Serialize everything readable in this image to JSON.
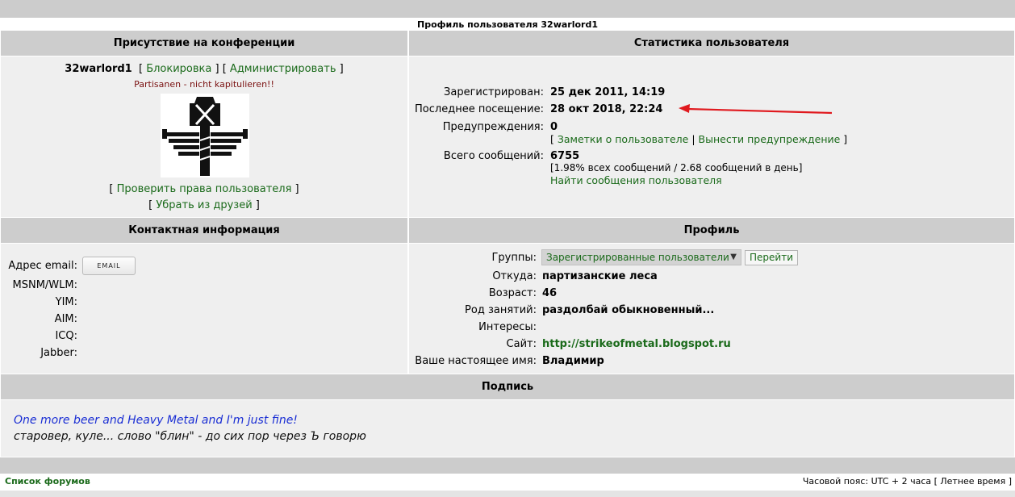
{
  "page": {
    "title": "Профиль пользователя 32warlord1"
  },
  "presence": {
    "header": "Присутствие на конференции",
    "username": "32warlord1",
    "block_link": "Блокировка",
    "admin_link": "Администрировать",
    "tagline": "Partisanen - nicht kapitulieren!!",
    "check_rights_link": "Проверить права пользователя",
    "remove_friend_link": "Убрать из друзей"
  },
  "stats": {
    "header": "Статистика пользователя",
    "registered_label": "Зарегистрирован:",
    "registered_value": "25 дек 2011, 14:19",
    "last_visit_label": "Последнее посещение:",
    "last_visit_value": "28 окт 2018, 22:24",
    "warnings_label": "Предупреждения:",
    "warnings_value": "0",
    "user_notes_link": "Заметки о пользователе",
    "issue_warning_link": "Вынести предупреждение",
    "total_posts_label": "Всего сообщений:",
    "total_posts_value": "6755",
    "posts_detail": "[1.98% всех сообщений / 2.68 сообщений в день]",
    "find_posts_link": "Найти сообщения пользователя"
  },
  "contact": {
    "header": "Контактная информация",
    "email_label": "Адрес email:",
    "email_button": "EMAIL",
    "msnm_label": "MSNM/WLM:",
    "yim_label": "YIM:",
    "aim_label": "AIM:",
    "icq_label": "ICQ:",
    "jabber_label": "Jabber:"
  },
  "profile": {
    "header": "Профиль",
    "groups_label": "Группы:",
    "groups_selected": "Зарегистрированные пользователи",
    "go_button": "Перейти",
    "location_label": "Откуда:",
    "location_value": "партизанские леса",
    "age_label": "Возраст:",
    "age_value": "46",
    "occupation_label": "Род занятий:",
    "occupation_value": "раздолбай обыкновенный...",
    "interests_label": "Интересы:",
    "website_label": "Сайт:",
    "website_value": "http://strikeofmetal.blogspot.ru",
    "realname_label": "Ваше настоящее имя:",
    "realname_value": "Владимир"
  },
  "signature": {
    "header": "Подпись",
    "line1": "One more beer and Heavy Metal and I'm just fine!",
    "line2": "старовер, куле... слово \"блин\" - до сих пор через Ъ говорю"
  },
  "footer": {
    "forum_list_link": "Список форумов",
    "timezone_text": "Часовой пояс: UTC + 2 часа [ Летнее время ]"
  },
  "colors": {
    "link": "#1a6a1a",
    "header_bg": "#cdcdcd",
    "panel_bg": "#efefef",
    "annotation_arrow": "#e0191e",
    "signature_blue": "#1a2ed4"
  }
}
